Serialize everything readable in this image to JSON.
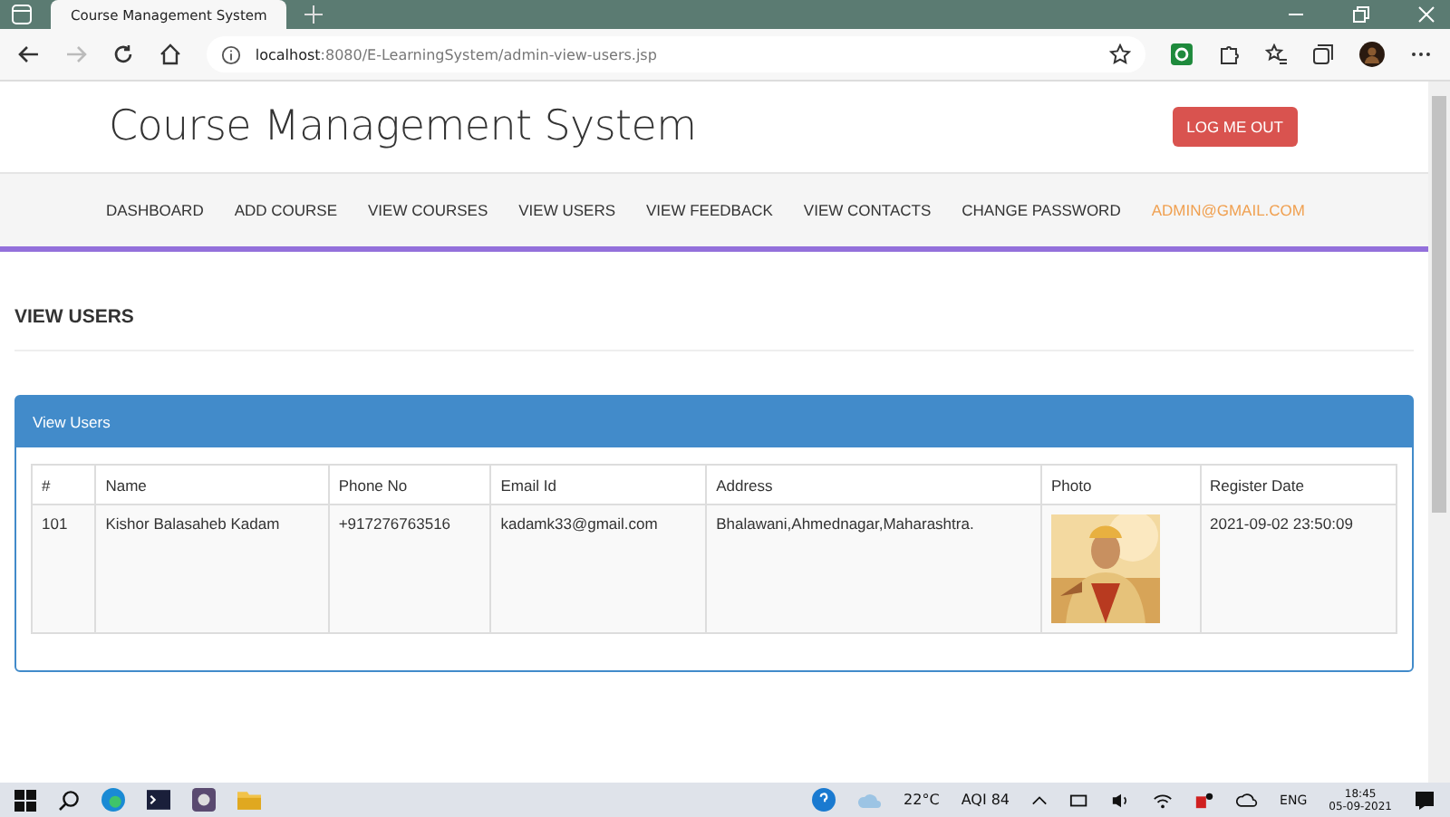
{
  "browser": {
    "tab_title": "Course Management System",
    "url_host": "localhost",
    "url_rest": ":8080/E-LearningSystem/admin-view-users.jsp"
  },
  "header": {
    "title": "Course Management System",
    "logout": "LOG ME OUT"
  },
  "nav": [
    {
      "label": "DASHBOARD",
      "kind": "link"
    },
    {
      "label": "ADD COURSE",
      "kind": "link"
    },
    {
      "label": "VIEW COURSES",
      "kind": "link"
    },
    {
      "label": "VIEW USERS",
      "kind": "link"
    },
    {
      "label": "VIEW FEEDBACK",
      "kind": "link"
    },
    {
      "label": "VIEW CONTACTS",
      "kind": "link"
    },
    {
      "label": "CHANGE PASSWORD",
      "kind": "link"
    },
    {
      "label": "ADMIN@GMAIL.COM",
      "kind": "account"
    }
  ],
  "page_heading": "VIEW USERS",
  "panel": {
    "title": "View Users",
    "table": {
      "columns": [
        "#",
        "Name",
        "Phone No",
        "Email Id",
        "Address",
        "Photo",
        "Register Date"
      ],
      "rows": [
        {
          "cells": [
            "101",
            "Kishor Balasaheb Kadam",
            "+917276763516",
            "kadamk33@gmail.com",
            "Bhalawani,Ahmednagar,Maharashtra.",
            {
              "kind": "picture"
            },
            "2021-09-02 23:50:09"
          ]
        }
      ]
    }
  },
  "taskbar": {
    "temperature": "22°C",
    "aqi": "AQI 84",
    "language": "ENG",
    "time": "18:45",
    "date": "05-09-2021"
  }
}
